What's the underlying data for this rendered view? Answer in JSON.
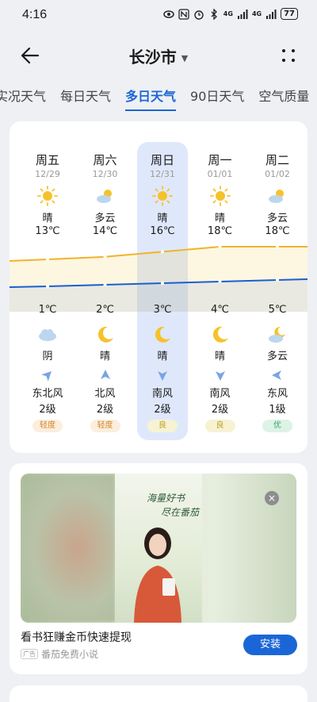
{
  "status_bar": {
    "time": "4:16",
    "battery": "77",
    "network": "4G"
  },
  "header": {
    "city": "长沙市",
    "caret": "▼"
  },
  "tabs": [
    {
      "label": "实况天气",
      "active": false
    },
    {
      "label": "每日天气",
      "active": false
    },
    {
      "label": "多日天气",
      "active": true
    },
    {
      "label": "90日天气",
      "active": false
    },
    {
      "label": "空气质量",
      "active": false
    }
  ],
  "forecast": [
    {
      "day": "周五",
      "date": "12/29",
      "cond": "晴",
      "day_icon": "sun-icon",
      "high": "13℃",
      "low": "1℃",
      "night_cond": "阴",
      "night_icon": "cloud-icon",
      "wind_dir": "东北风",
      "wind_level": "2级",
      "aqi": "轻度",
      "aqi_class": "light",
      "wind_arrow": "northeast"
    },
    {
      "day": "周六",
      "date": "12/30",
      "cond": "多云",
      "day_icon": "partly-cloudy-icon",
      "high": "14℃",
      "low": "2℃",
      "night_cond": "晴",
      "night_icon": "moon-icon",
      "wind_dir": "北风",
      "wind_level": "2级",
      "aqi": "轻度",
      "aqi_class": "light",
      "wind_arrow": "north"
    },
    {
      "day": "周日",
      "date": "12/31",
      "cond": "晴",
      "day_icon": "sun-icon",
      "high": "16℃",
      "low": "3℃",
      "night_cond": "晴",
      "night_icon": "moon-icon",
      "wind_dir": "南风",
      "wind_level": "2级",
      "aqi": "良",
      "aqi_class": "good",
      "wind_arrow": "south"
    },
    {
      "day": "周一",
      "date": "01/01",
      "cond": "晴",
      "day_icon": "sun-icon",
      "high": "18℃",
      "low": "4℃",
      "night_cond": "晴",
      "night_icon": "moon-icon",
      "wind_dir": "南风",
      "wind_level": "2级",
      "aqi": "良",
      "aqi_class": "good",
      "wind_arrow": "south"
    },
    {
      "day": "周二",
      "date": "01/02",
      "cond": "多云",
      "day_icon": "partly-cloudy-icon",
      "high": "18℃",
      "low": "5℃",
      "night_cond": "多云",
      "night_icon": "partly-cloudy-night-icon",
      "wind_dir": "东风",
      "wind_level": "1级",
      "aqi": "优",
      "aqi_class": "best",
      "wind_arrow": "east"
    }
  ],
  "chart_colors": {
    "high": "#f0b429",
    "low": "#1b5fd0"
  },
  "ad": {
    "title": "看书狂赚金币快速提现",
    "tag": "广告",
    "source": "番茄免费小说",
    "install_label": "安装",
    "close_label": "×",
    "poster_line1": "海量好书",
    "poster_line2": "尽在番茄"
  }
}
